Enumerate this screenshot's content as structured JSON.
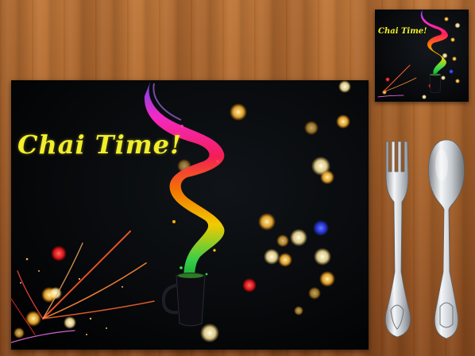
{
  "placemat": {
    "title": "Chai Time!"
  },
  "coaster": {
    "title": "Chai Time!"
  },
  "colors": {
    "wood": "#b06a30",
    "mat_background": "#050608",
    "title_yellow": "#f2ee2a",
    "splash": [
      "#7d3cff",
      "#ff2bd0",
      "#ff1e5a",
      "#ff7a00",
      "#ffd400",
      "#38d84a"
    ],
    "steel": "#c9ced3"
  },
  "objects": [
    "fork-icon",
    "spoon-icon",
    "cup-icon"
  ]
}
